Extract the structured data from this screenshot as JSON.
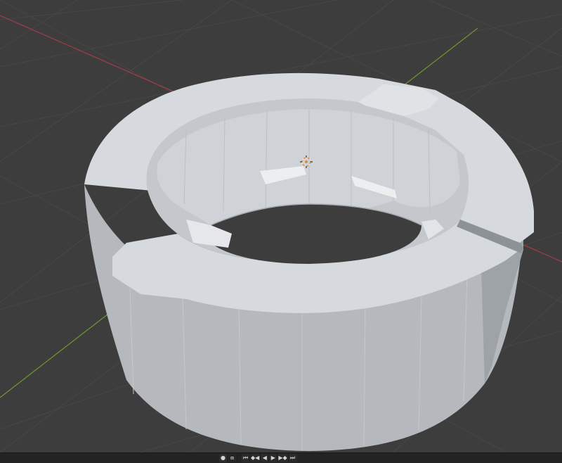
{
  "app": {
    "theme": {
      "background": "#3d3d3d",
      "grid_line": "#474747",
      "x_axis": "#a63d46",
      "y_axis": "#6e9a2e",
      "mesh_light": "#d5d8dc",
      "mesh_mid": "#b4b8bc",
      "mesh_dark": "#8f9499"
    }
  },
  "viewport": {
    "object": "hollow-ring-mesh",
    "origin_marker_icon": "object-origin-icon",
    "grid_visible": true
  },
  "timeline": {
    "controls": [
      {
        "icon": "record-icon",
        "glyph": "●"
      },
      {
        "icon": "keyframe-icon",
        "glyph": "⧈"
      },
      {
        "icon": "jump-to-start-icon",
        "glyph": "⏮"
      },
      {
        "icon": "previous-keyframe-icon",
        "glyph": "◆◀"
      },
      {
        "icon": "play-reverse-icon",
        "glyph": "◀"
      },
      {
        "icon": "play-icon",
        "glyph": "▶"
      },
      {
        "icon": "next-keyframe-icon",
        "glyph": "▶◆"
      },
      {
        "icon": "jump-to-end-icon",
        "glyph": "⏭"
      }
    ]
  }
}
